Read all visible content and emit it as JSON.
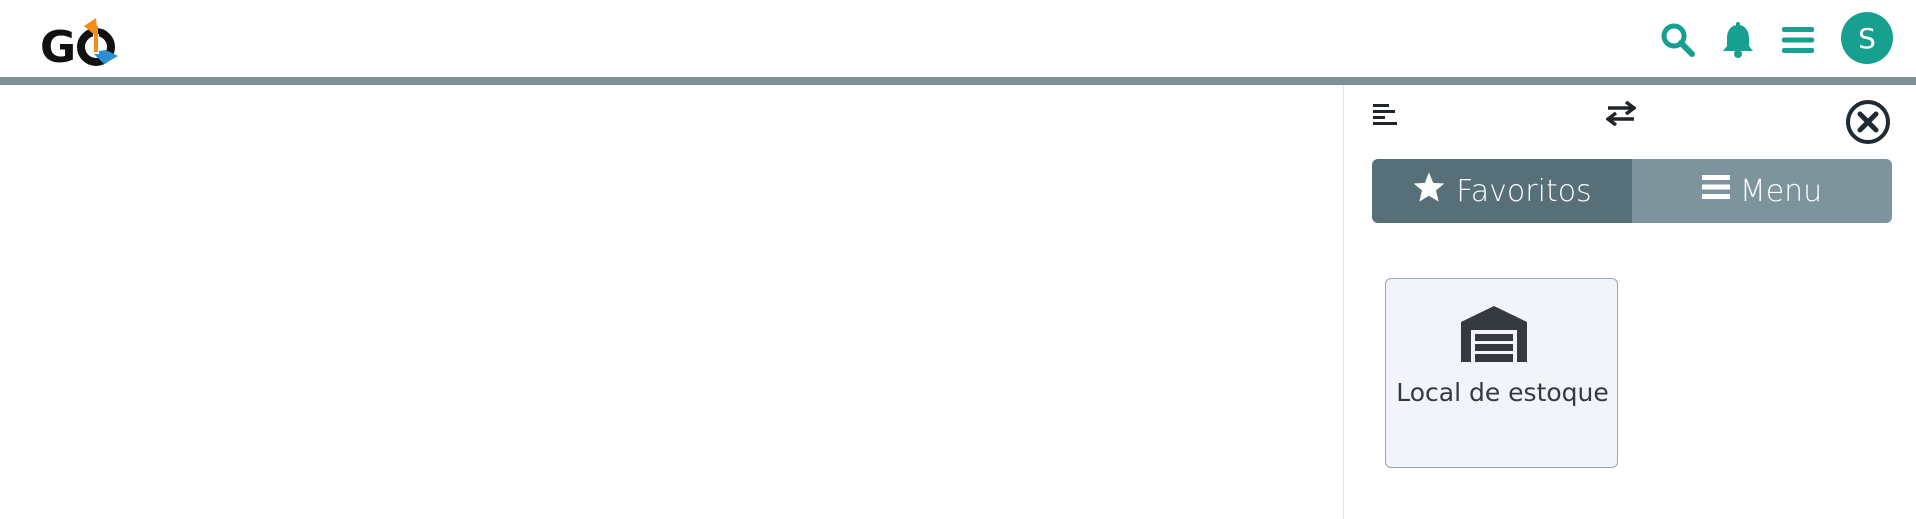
{
  "header": {
    "logo_icon": "go-logo",
    "search_icon": "search-icon",
    "notifications_icon": "bell-icon",
    "menu_icon": "hamburger-icon",
    "avatar_initial": "S",
    "accent_color": "#17a08f",
    "bar_color": "#7d9098"
  },
  "panel": {
    "align_icon": "align-left-icon",
    "swap_icon": "swap-arrows-icon",
    "close_icon": "close-circle-icon",
    "tabs": [
      {
        "label": "Favoritos",
        "icon": "star-icon",
        "active": true,
        "color": "#576f79"
      },
      {
        "label": "Menu",
        "icon": "bars-icon",
        "active": false,
        "color": "#7d949d"
      }
    ],
    "favorites": [
      {
        "label": "Local de estoque",
        "icon": "warehouse-icon"
      }
    ]
  }
}
